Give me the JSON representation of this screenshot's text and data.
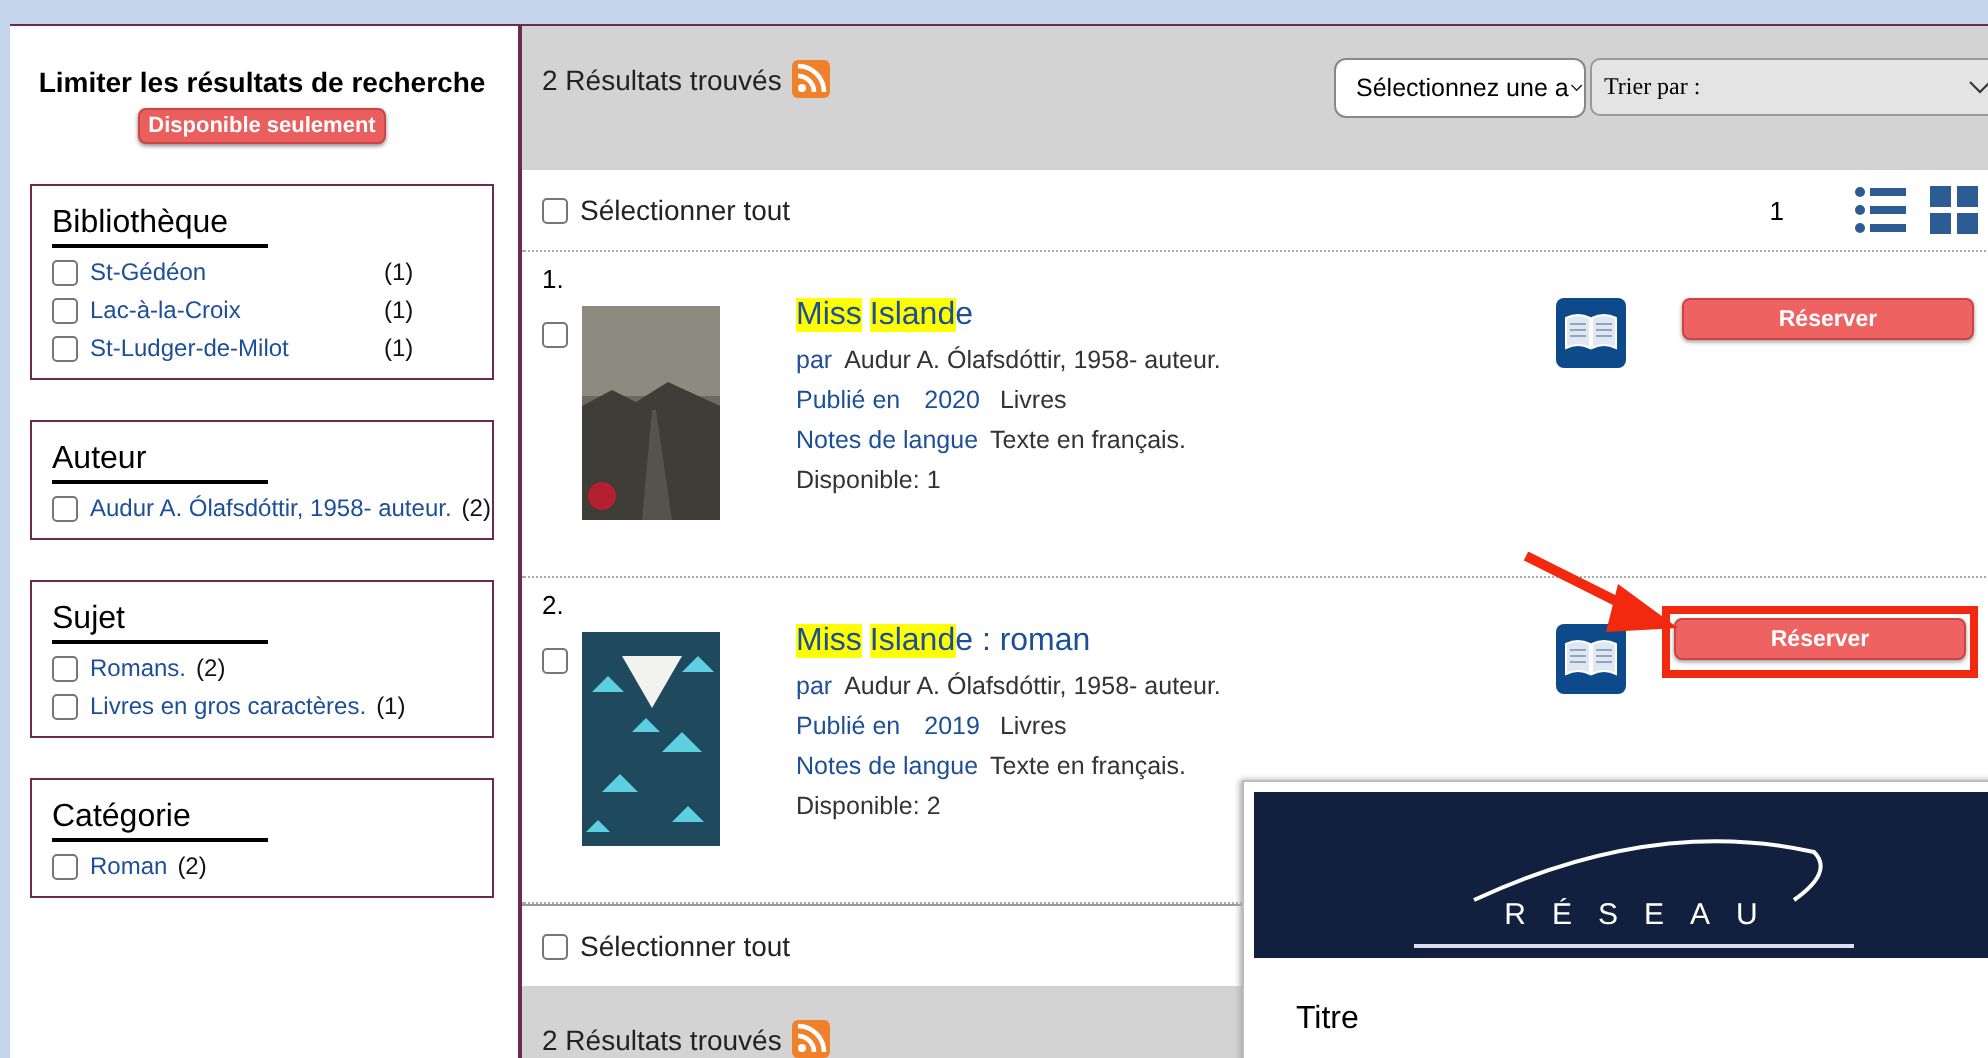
{
  "sidebar": {
    "title": "Limiter les résultats de recherche",
    "available_only_button": "Disponible seulement",
    "facets": [
      {
        "heading": "Bibliothèque",
        "items": [
          {
            "label": "St-Gédéon",
            "count": "(1)",
            "checked": false
          },
          {
            "label": "Lac-à-la-Croix",
            "count": "(1)",
            "checked": false
          },
          {
            "label": "St-Ludger-de-Milot",
            "count": "(1)",
            "checked": false
          }
        ]
      },
      {
        "heading": "Auteur",
        "items": [
          {
            "label": "Audur A. Ólafsdóttir, 1958- auteur.",
            "count": "(2)",
            "checked": false
          }
        ]
      },
      {
        "heading": "Sujet",
        "items": [
          {
            "label": "Romans.",
            "count": "(2)",
            "checked": false
          },
          {
            "label": "Livres en gros caractères.",
            "count": "(1)",
            "checked": false
          }
        ]
      },
      {
        "heading": "Catégorie",
        "items": [
          {
            "label": "Roman",
            "count": "(2)",
            "checked": false
          }
        ]
      }
    ]
  },
  "results_header": {
    "count_text": "2 Résultats trouvés",
    "select_placeholder": "Sélectionnez une a",
    "sort_placeholder": "Trier par :"
  },
  "toolbar": {
    "select_all": "Sélectionner tout",
    "checked": false,
    "page": "1"
  },
  "records": [
    {
      "number": "1.",
      "checked": false,
      "kind": "photo",
      "title_parts": [
        {
          "text": "Miss",
          "highlight": true
        },
        {
          "text": "Island",
          "highlight": true
        },
        {
          "text": "e",
          "highlight": false
        }
      ],
      "by_label": "par",
      "author": "Audur A. Ólafsdóttir, 1958- auteur.",
      "published_label": "Publié en",
      "year": "2020",
      "format": "Livres",
      "notes_label": "Notes de langue",
      "notes": "Texte en français.",
      "availability": "Disponible: 1",
      "reserve": "Réserver",
      "highlighted": false
    },
    {
      "number": "2.",
      "checked": false,
      "kind": "pattern",
      "title_parts": [
        {
          "text": "Miss",
          "highlight": true
        },
        {
          "text": "Island",
          "highlight": true
        },
        {
          "text": "e : roman",
          "highlight": false
        }
      ],
      "by_label": "par",
      "author": "Audur A. Ólafsdóttir, 1958- auteur.",
      "published_label": "Publié en",
      "year": "2019",
      "format": "Livres",
      "notes_label": "Notes de langue",
      "notes": "Texte en français.",
      "availability": "Disponible: 2",
      "reserve": "Réserver",
      "highlighted": true
    }
  ],
  "bottom_toolbar": {
    "select_all": "Sélectionner tout",
    "checked": false
  },
  "bottom_header": {
    "count_text": "2 Résultats trouvés"
  },
  "popup": {
    "logo_text": "RÉSEAU",
    "field_label": "Titre"
  }
}
